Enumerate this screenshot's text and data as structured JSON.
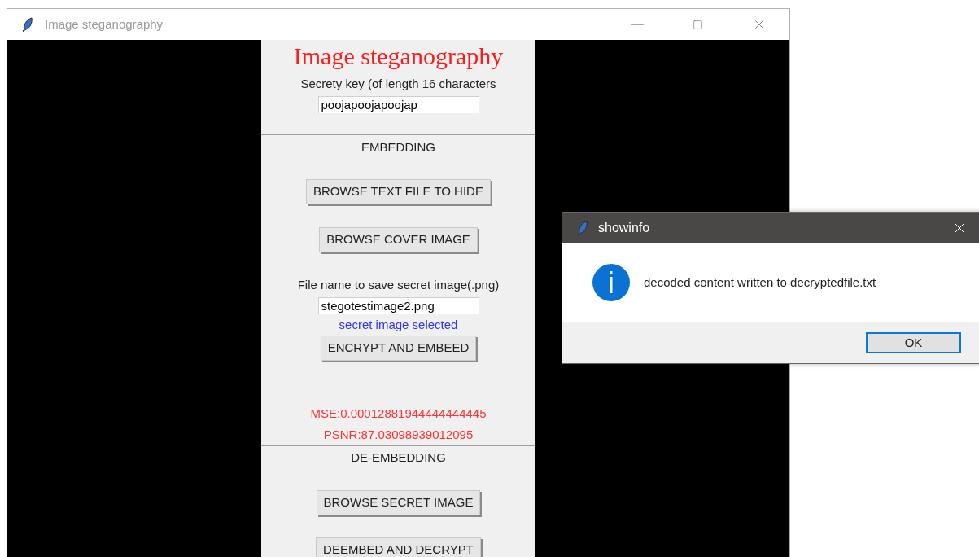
{
  "main_window": {
    "title": "Image steganography",
    "sections": [
      {
        "items": [
          {
            "kind": "heading",
            "text": "Image steganography"
          },
          {
            "kind": "label",
            "text": "Secrety key (of length 16 characters"
          },
          {
            "kind": "field",
            "value": "poojapoojapoojap"
          }
        ]
      },
      {
        "items": [
          {
            "kind": "label",
            "text": "EMBEDDING"
          },
          {
            "kind": "button",
            "text": "BROWSE TEXT FILE TO HIDE"
          },
          {
            "kind": "button",
            "text": "BROWSE COVER IMAGE"
          },
          {
            "kind": "label",
            "text": "File name to save secret image(.png)"
          },
          {
            "kind": "field",
            "value": "stegotestimage2.png"
          },
          {
            "kind": "note",
            "text": "secret image selected",
            "color": "#3333ff"
          },
          {
            "kind": "button",
            "text": "ENCRYPT AND EMBEED"
          },
          {
            "kind": "note",
            "text": "MSE:0.00012881944444444445",
            "color": "#ff3333"
          },
          {
            "kind": "note",
            "text": "PSNR:87.03098939012095",
            "color": "#ff3333"
          }
        ]
      },
      {
        "items": [
          {
            "kind": "label",
            "text": "DE-EMBEDDING"
          },
          {
            "kind": "button",
            "text": "BROWSE SECRET IMAGE"
          },
          {
            "kind": "button",
            "text": "DEEMBED AND DECRYPT"
          }
        ]
      }
    ]
  },
  "dialog": {
    "title": "showinfo",
    "message": "decoded content written to decryptedfile.txt",
    "buttons": [
      "OK"
    ]
  }
}
